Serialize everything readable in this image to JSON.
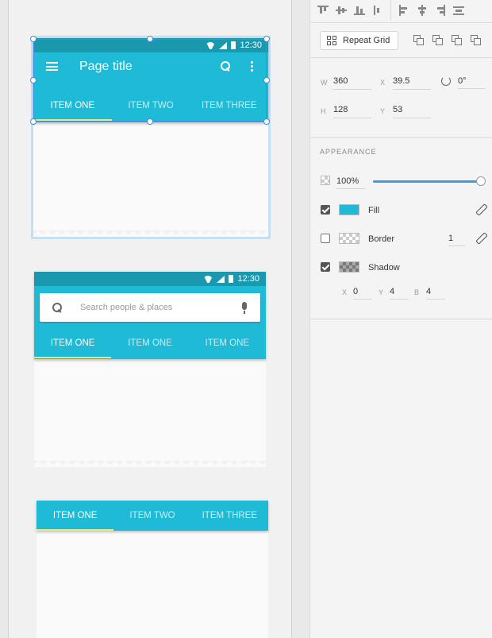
{
  "canvas": {
    "card1": {
      "status_time": "12:30",
      "page_title": "Page title",
      "tabs": [
        "ITEM ONE",
        "ITEM TWO",
        "ITEM THREE"
      ]
    },
    "card2": {
      "status_time": "12:30",
      "search_placeholder": "Search people & places",
      "tabs": [
        "ITEM ONE",
        "ITEM ONE",
        "ITEM ONE"
      ]
    },
    "card3": {
      "tabs": [
        "ITEM ONE",
        "ITEM TWO",
        "ITEM THREE"
      ]
    },
    "colors": {
      "appbar": "#1fbad6",
      "statusbar": "#1998ae",
      "tab_indicator": "#e6ee7a",
      "selection": "#3f8fe0"
    }
  },
  "panel": {
    "repeat_grid_label": "Repeat Grid",
    "geometry": {
      "w_label": "W",
      "w_value": "360",
      "x_label": "X",
      "x_value": "39.5",
      "rotation_value": "0°",
      "h_label": "H",
      "h_value": "128",
      "y_label": "Y",
      "y_value": "53"
    },
    "appearance": {
      "heading": "APPEARANCE",
      "opacity": "100%",
      "opacity_fraction": 1.0,
      "fill_label": "Fill",
      "fill_checked": true,
      "fill_color": "#1fbad6",
      "border_label": "Border",
      "border_checked": false,
      "border_width": "1",
      "shadow_label": "Shadow",
      "shadow_checked": true,
      "shadow_x_label": "X",
      "shadow_x": "0",
      "shadow_y_label": "Y",
      "shadow_y": "4",
      "shadow_b_label": "B",
      "shadow_b": "4"
    }
  }
}
